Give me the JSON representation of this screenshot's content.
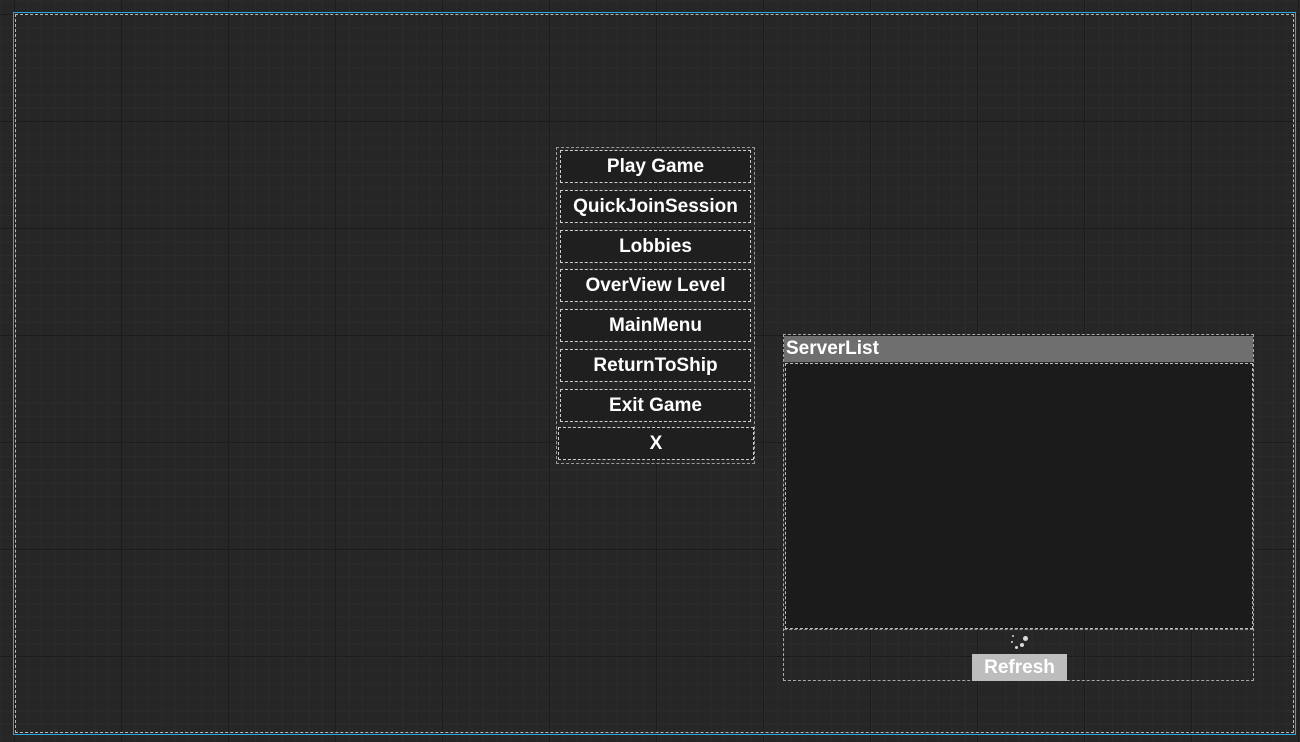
{
  "menu": {
    "buttons": [
      {
        "label": "Play Game"
      },
      {
        "label": "QuickJoinSession"
      },
      {
        "label": "Lobbies"
      },
      {
        "label": "OverView Level"
      },
      {
        "label": "MainMenu"
      },
      {
        "label": "ReturnToShip"
      },
      {
        "label": "Exit Game"
      }
    ],
    "close_label": "X"
  },
  "server_list": {
    "title": "ServerList",
    "refresh_label": "Refresh",
    "loading_icon": "loading-spinner-icon"
  },
  "colors": {
    "canvas_bg": "#262626",
    "root_outline": "#2aa7e6",
    "header_bg": "#6f6f6f",
    "refresh_bg": "#bdbdbd"
  }
}
